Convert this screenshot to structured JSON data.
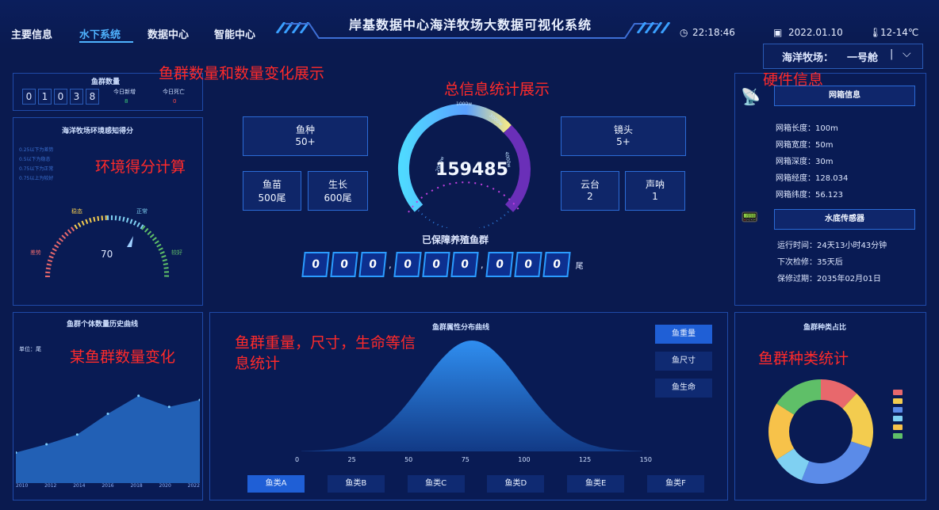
{
  "header": {
    "nav": [
      "主要信息",
      "水下系统",
      "数据中心",
      "智能中心"
    ],
    "active_nav_index": 1,
    "title": "岸基数据中心海洋牧场大数据可视化系统",
    "time": "22:18:46",
    "date": "2022.01.10",
    "temperature": "12-14℃",
    "farm_label": "海洋牧场：",
    "farm_value": "一号舱",
    "farm_sep": "|",
    "icons": {
      "time": "clock-icon",
      "date": "calendar-icon",
      "temp": "thermometer-icon",
      "dropdown": "chevron-down-icon"
    }
  },
  "annotations": {
    "fish_count_change": "鱼群数量和数量变化展示",
    "total_stats": "总信息统计展示",
    "hardware": "硬件信息",
    "env_score": "环境得分计算",
    "single_change": "某鱼群数量变化",
    "attr_stats": "鱼群重量，尺寸，生命等信息统计",
    "species_stats": "鱼群种类统计"
  },
  "fish_count": {
    "title": "鱼群数量",
    "digits": [
      "0",
      "1",
      "0",
      "3",
      "8"
    ],
    "today_new_label": "今日新增",
    "today_dead_label": "今日死亡",
    "today_new_value": "8",
    "today_dead_value": "0"
  },
  "env": {
    "title": "海洋牧场环境感知得分",
    "legend": [
      "0.25以下为差势",
      "0.5以下为稳态",
      "0.75以下为正常",
      "0.75以上为较好"
    ],
    "labels": [
      "差势",
      "稳态",
      "正常",
      "较好"
    ],
    "score": "70",
    "score_value": 70
  },
  "stats": {
    "species_label": "鱼种",
    "species_value": "50+",
    "fry_label": "鱼苗",
    "fry_value": "500尾",
    "growth_label": "生长",
    "growth_value": "600尾",
    "lens_label": "镜头",
    "lens_value": "5+",
    "ptz_label": "云台",
    "ptz_value": "2",
    "sonar_label": "声呐",
    "sonar_value": "1",
    "gauge_value": "159485",
    "gauge_ticks": [
      "2000w",
      "1000w",
      "3000w",
      "4000w"
    ],
    "protected_title": "已保障养殖鱼群",
    "protected_digits": [
      "0",
      "0",
      "0",
      "0",
      "0",
      "0",
      "0",
      "0",
      "0"
    ],
    "protected_unit": "尾",
    "sep": ","
  },
  "hardware": {
    "net_title": "网箱信息",
    "net_items": [
      "网箱长度：100m",
      "网箱宽度：50m",
      "网箱深度：30m",
      "网箱经度：128.034",
      "网箱纬度：56.123"
    ],
    "sensor_title": "水底传感器",
    "sensor_items": [
      "运行时间：24天13小时43分钟",
      "下次检修：35天后",
      "保修过期：2035年02月01日"
    ],
    "icons": {
      "net": "satellite-dish-icon",
      "sensor": "sensor-icon"
    }
  },
  "history": {
    "title": "鱼群个体数量历史曲线",
    "unit": "单位：尾",
    "x_ticks": [
      "2010",
      "2012",
      "2014",
      "2016",
      "2018",
      "2020",
      "2022"
    ]
  },
  "distribution": {
    "title": "鱼群属性分布曲线",
    "buttons": [
      "鱼重量",
      "鱼尺寸",
      "鱼生命"
    ],
    "tabs": [
      "鱼类A",
      "鱼类B",
      "鱼类C",
      "鱼类D",
      "鱼类E",
      "鱼类F"
    ]
  },
  "species": {
    "title": "鱼群种类占比",
    "colors": [
      "#e8686c",
      "#f3cc4f",
      "#5b8be8",
      "#7fd0f2",
      "#f7c24a",
      "#5fbf68"
    ]
  },
  "chart_data": [
    {
      "type": "line",
      "title": "鱼群个体数量历史曲线",
      "ylabel": "单位：尾",
      "x": [
        "2010",
        "2012",
        "2014",
        "2016",
        "2018",
        "2020",
        "2022"
      ],
      "series": [
        {
          "values": [
            22,
            28,
            35,
            50,
            63,
            55,
            60
          ]
        }
      ]
    },
    {
      "type": "area",
      "title": "鱼群属性分布曲线",
      "x": [
        0,
        25,
        50,
        75,
        100,
        125,
        150
      ],
      "xlim": [
        0,
        150
      ],
      "series": [
        {
          "values": [
            0.2,
            4,
            30,
            100,
            30,
            4,
            0.2
          ]
        }
      ]
    },
    {
      "type": "pie",
      "title": "鱼群种类占比",
      "slices": [
        12,
        18,
        26,
        10,
        18,
        16
      ]
    }
  ]
}
